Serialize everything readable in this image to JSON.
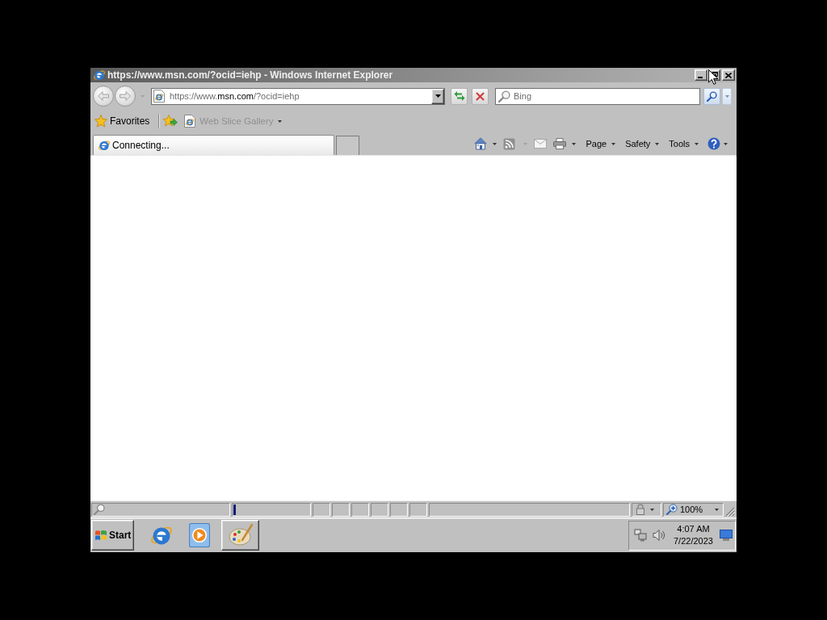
{
  "window": {
    "title": "https://www.msn.com/?ocid=iehp - Windows Internet Explorer",
    "active": false
  },
  "address_bar": {
    "address": {
      "prefix": "https://www.",
      "domain": "msn.com",
      "suffix": "/?ocid=iehp"
    }
  },
  "search": {
    "placeholder": "Bing"
  },
  "favorites_bar": {
    "label": "Favorites",
    "items": [
      {
        "label": "Web Slice Gallery",
        "disabled": true
      }
    ]
  },
  "tabs": [
    {
      "label": "Connecting...",
      "selected": true
    }
  ],
  "command_bar": {
    "menus": [
      {
        "label": "Page"
      },
      {
        "label": "Safety"
      },
      {
        "label": "Tools"
      }
    ]
  },
  "status_bar": {
    "progress": {
      "level": 0.03
    },
    "zoom": "100%"
  },
  "taskbar": {
    "start": "Start",
    "clock": {
      "time": "4:07 AM",
      "date": "7/22/2023"
    }
  }
}
